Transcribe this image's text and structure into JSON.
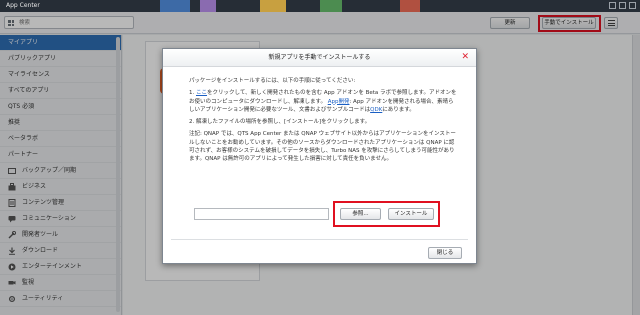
{
  "window": {
    "title": "App Center"
  },
  "colors": {
    "accent": "#2f6fb6",
    "highlight": "#e01020",
    "title_bar": "#262d36",
    "link": "#1a5fc4"
  },
  "toolbar": {
    "search_placeholder": "検索",
    "refresh_label": "更新",
    "manual_install_label": "手動でインストール",
    "menu_icon": "list-menu-icon"
  },
  "sidebar": {
    "items": [
      {
        "label": "マイアプリ",
        "active": true
      },
      {
        "label": "パブリックアプリ"
      },
      {
        "label": "マイライセンス"
      },
      {
        "label": "すべてのアプリ"
      },
      {
        "label": "QTS 必須"
      },
      {
        "label": "推奨"
      },
      {
        "label": "ベータラボ"
      },
      {
        "label": "パートナー"
      }
    ],
    "categories": [
      {
        "label": "バックアップ／同期",
        "icon": "backup-icon"
      },
      {
        "label": "ビジネス",
        "icon": "business-icon"
      },
      {
        "label": "コンテンツ管理",
        "icon": "content-icon"
      },
      {
        "label": "コミュニケーション",
        "icon": "communication-icon"
      },
      {
        "label": "開発者ツール",
        "icon": "developer-icon"
      },
      {
        "label": "ダウンロード",
        "icon": "download-icon"
      },
      {
        "label": "エンターテインメント",
        "icon": "entertainment-icon"
      },
      {
        "label": "監視",
        "icon": "surveillance-icon"
      },
      {
        "label": "ユーティリティ",
        "icon": "utility-icon"
      }
    ]
  },
  "dialog": {
    "title": "新規アプリを手動でインストールする",
    "intro": "パッケージをインストールするには、以下の手順に従ってください:",
    "step1_prefix": "1. ",
    "step1_link": "ここ",
    "step1_text": "をクリックして、新しく開発されたものを含む App アドオンを Beta ラボで参照します。アドオンをお使いのコンピュータにダウンロードし、解凍します。",
    "step1b_link": "App開発",
    "step1b_text": ": App アドオンを開発される場合、素晴らしいアプリケーション開発に必要なツール、文書およびサンプルコードは",
    "step1b_link2": "QDK",
    "step1b_suffix": "にあります。",
    "step2": "2. 解凍したファイルの場所を参照し、[インストール]をクリックします。",
    "note": "注記: QNAP では、QTS App Center または QNAP ウェブサイト以外からはアプリケーションをインストールしないことをお勧めしています。その他のソースからダウンロードされたアプリケーションは QNAP に認可されず、お客様のシステムを破損してデータを損失し、Turbo NAS を攻撃にさらしてしまう可能性があります。QNAP は無許可のアプリによって発生した損害に対して責任を負いません。",
    "browse_label": "参照...",
    "install_label": "インストール",
    "close_label": "閉じる",
    "close_icon": "close-x-icon"
  }
}
